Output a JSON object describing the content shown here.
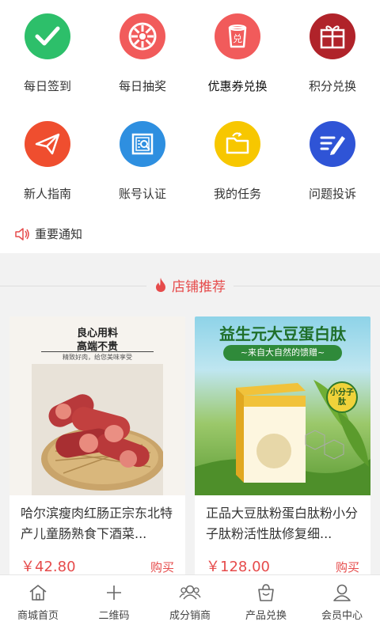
{
  "grid": [
    {
      "label": "每日签到",
      "icon": "checkmark-icon",
      "color": "#2dbf6a"
    },
    {
      "label": "每日抽奖",
      "icon": "lottery-wheel-icon",
      "color": "#f15b5b"
    },
    {
      "label": "优惠券兑换",
      "icon": "coupon-cup-icon",
      "color": "#f15b5b"
    },
    {
      "label": "积分兑换",
      "icon": "gift-box-icon",
      "color": "#b0232a"
    },
    {
      "label": "新人指南",
      "icon": "paper-plane-icon",
      "color": "#ef4e2f"
    },
    {
      "label": "账号认证",
      "icon": "safe-box-icon",
      "color": "#2e8fe0"
    },
    {
      "label": "我的任务",
      "icon": "folder-icon",
      "color": "#f7c700"
    },
    {
      "label": "问题投诉",
      "icon": "edit-list-icon",
      "color": "#2f54d6"
    }
  ],
  "notice": {
    "label": "重要通知",
    "icon": "speaker-icon"
  },
  "section": {
    "title": "店铺推荐",
    "icon": "flame-icon"
  },
  "products": [
    {
      "name": "哈尔滨瘦肉红肠正宗东北特产儿童肠熟食下酒菜...",
      "price": "￥42.80",
      "buy": "购买",
      "img_text": {
        "line1": "良心用料",
        "line2": "高端不贵",
        "line3": "精致好肉，给您美味享受"
      }
    },
    {
      "name": "正品大豆肽粉蛋白肽粉小分子肽粉活性肽修复细...",
      "price": "￥128.00",
      "buy": "购买",
      "img_text": {
        "title": "益生元大豆蛋白肽",
        "ribbon": "~来自大自然的馈赠~",
        "badge": "小分子肽"
      }
    }
  ],
  "tabbar": [
    {
      "label": "商城首页",
      "icon": "home-icon"
    },
    {
      "label": "二维码",
      "icon": "plus-icon"
    },
    {
      "label": "成分销商",
      "icon": "users-icon"
    },
    {
      "label": "产品兑换",
      "icon": "shopping-bag-icon"
    },
    {
      "label": "会员中心",
      "icon": "user-icon"
    }
  ]
}
